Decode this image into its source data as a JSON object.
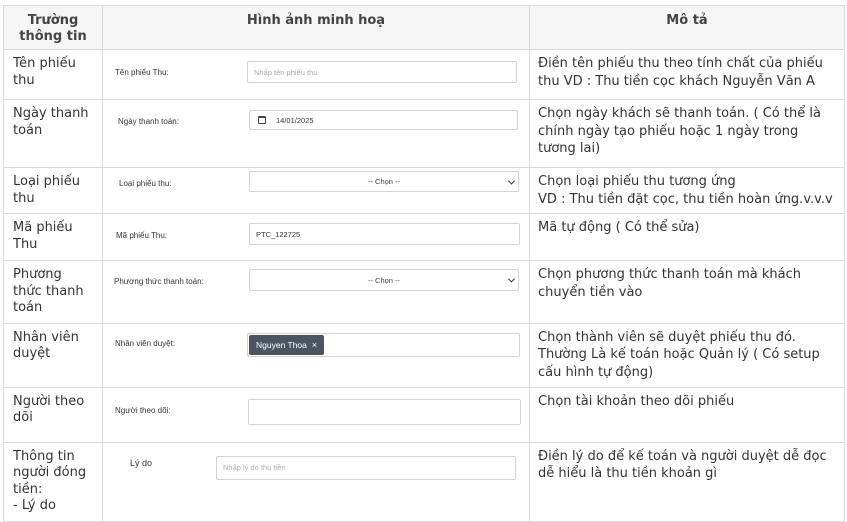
{
  "headers": {
    "field": "Trường thông tin",
    "illustration": "Hình ảnh minh hoạ",
    "description": "Mô tả"
  },
  "rows": [
    {
      "field": "Tên phiếu thu",
      "form_label": "Tên phiếu Thu:",
      "input_placeholder": "Nhập tên phiếu thu",
      "description": "Điền tên phiếu thu theo tính chất của phiếu thu VD : Thu tiền cọc khách Nguyễn Văn A"
    },
    {
      "field": "Ngày thanh toán",
      "form_label": "Ngày thanh toán:",
      "input_value": "14/01/2025",
      "input_icon": "calendar-icon",
      "description": "Chọn ngày khách sẽ thanh toán. ( Có thể là chính ngày tạo phiếu hoặc 1 ngày trong tương lai)"
    },
    {
      "field": "Loại phiếu thu",
      "form_label": "Loại phiếu thu:",
      "select_value": "-- Chọn --",
      "description": "Chọn loại phiếu thu tương ứng\nVD : Thu tiền đặt cọc, thu tiền hoàn ứng.v.v.v"
    },
    {
      "field": "Mã phiếu Thu",
      "form_label": "Mã phiếu Thu:",
      "input_value": "PTC_122725",
      "description": "Mã tự động ( Có thể sửa)"
    },
    {
      "field": "Phương thức thanh toán",
      "form_label": "Phương thức thanh toán:",
      "select_value": "-- Chọn --",
      "description": "Chọn phương thức thanh toán mà khách chuyển tiền vào"
    },
    {
      "field": "Nhân viên duyệt",
      "form_label": "Nhân viên duyệt:",
      "tag_label": "Nguyen Thoa",
      "tag_remove": "×",
      "description": "Chọn thành viên sẽ duyệt phiếu thu đó. Thường Là kế toán hoặc Quản lý ( Có setup cấu hình tự động)"
    },
    {
      "field": "Người theo dõi",
      "form_label": "Người theo dõi:",
      "input_value": "",
      "description": "Chọn tài khoản theo dõi phiếu"
    },
    {
      "field": "Thông tin người đóng tiền:\n- Lý do",
      "form_label": "Lý do",
      "input_placeholder": "Nhập lý do thu tiền",
      "description": "Điền lý do để kế toán và người duyệt dễ đọc dễ hiểu là thu tiền khoản gì"
    }
  ]
}
